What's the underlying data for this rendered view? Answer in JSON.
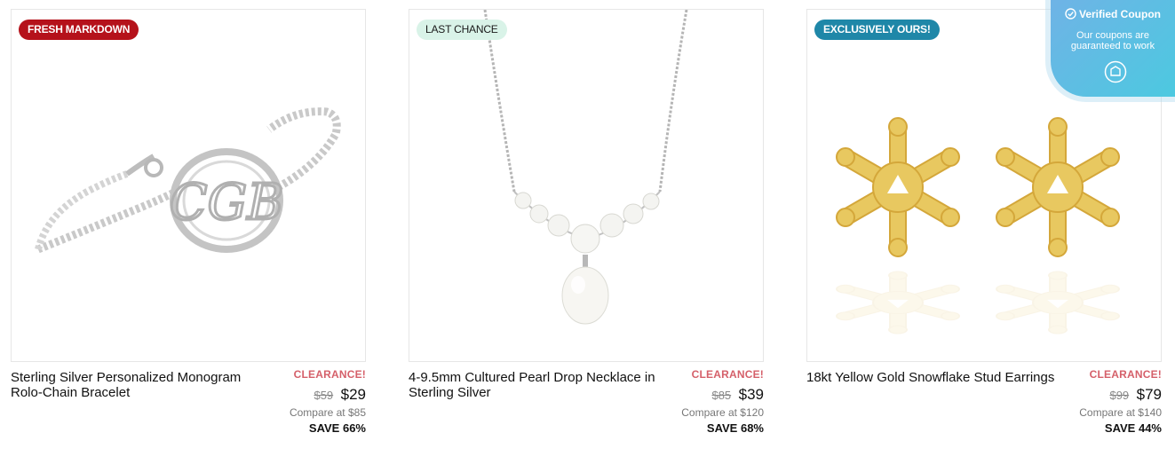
{
  "products": [
    {
      "badge": "FRESH MARKDOWN",
      "title": "Sterling Silver Personalized Monogram Rolo-Chain Bracelet",
      "clearance": "CLEARANCE!",
      "old_price": "$59",
      "new_price": "$29",
      "compare": "Compare at $85",
      "save": "SAVE 66%",
      "monogram": "CGB"
    },
    {
      "badge": "LAST CHANCE",
      "title": "4-9.5mm Cultured Pearl Drop Necklace in Sterling Silver",
      "clearance": "CLEARANCE!",
      "old_price": "$85",
      "new_price": "$39",
      "compare": "Compare at $120",
      "save": "SAVE 68%"
    },
    {
      "badge": "EXCLUSIVELY OURS!",
      "title": "18kt Yellow Gold Snowflake Stud Earrings",
      "clearance": "CLEARANCE!",
      "old_price": "$99",
      "new_price": "$79",
      "compare": "Compare at $140",
      "save": "SAVE 44%"
    }
  ],
  "coupon": {
    "title": "Verified Coupon",
    "subtitle": "Our coupons are guaranteed to work",
    "icon": "coupon-shield-icon"
  },
  "colors": {
    "fresh_markdown": "#b5121b",
    "last_chance": "#d9f3e8",
    "exclusive": "#1f87a8",
    "clearance": "#d5606a"
  }
}
